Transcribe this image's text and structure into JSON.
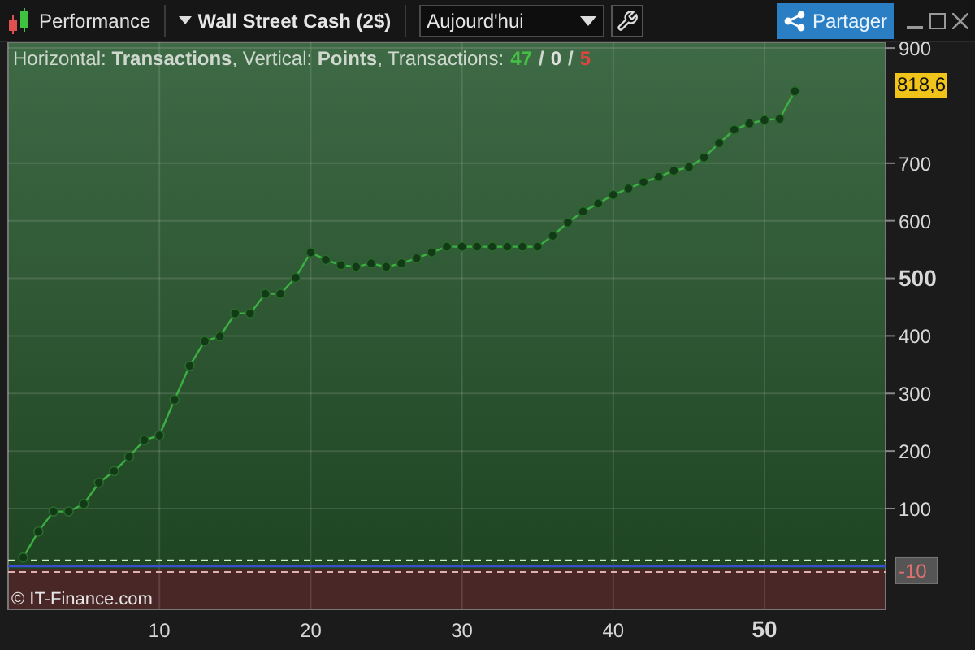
{
  "toolbar": {
    "title": "Performance",
    "instrument": "Wall Street Cash (2$)",
    "period": {
      "value": "Aujourd'hui"
    },
    "share_button": "Partager"
  },
  "legend": {
    "text": "Horizontal: **Transactions**, Vertical: **Points**, Transactions:",
    "counts": [
      {
        "value": "47",
        "color": "#44c144"
      },
      {
        "value": "0",
        "color": "#e0e0e0"
      },
      {
        "value": "5",
        "color": "#e0453f"
      }
    ],
    "separator": "/"
  },
  "watermark": "© IT-Finance.com",
  "current_value": "818,6",
  "chart_data": {
    "type": "line",
    "grid": true,
    "xlim": [
      0,
      58
    ],
    "ylim": [
      -75,
      910
    ],
    "x": [
      1,
      2,
      3,
      4,
      5,
      6,
      7,
      8,
      9,
      10,
      11,
      12,
      13,
      14,
      15,
      16,
      17,
      18,
      19,
      20,
      21,
      22,
      23,
      24,
      25,
      26,
      27,
      28,
      29,
      30,
      31,
      32,
      33,
      34,
      35,
      36,
      37,
      38,
      39,
      40,
      41,
      42,
      43,
      44,
      45,
      46,
      47,
      48,
      49,
      50,
      51,
      52
    ],
    "ref_lines": [
      {
        "axis": "y",
        "value": 10,
        "color": "#c8f0c0"
      },
      {
        "axis": "y",
        "value": 0,
        "color": "#3a4fd0"
      },
      {
        "axis": "y",
        "value": -10,
        "label": "-10",
        "color": "#e0b0b0"
      }
    ],
    "series": [
      {
        "marker": "circle",
        "color": "#3cb043",
        "values": [
          15,
          60,
          95,
          95,
          108,
          145,
          165,
          190,
          219,
          227,
          289,
          348,
          391,
          399,
          439,
          439,
          473,
          473,
          501,
          545,
          532,
          523,
          520,
          526,
          520,
          526,
          535,
          545,
          555,
          555,
          555,
          555,
          555,
          555,
          555,
          574,
          597,
          616,
          630,
          645,
          656,
          667,
          676,
          687,
          693,
          710,
          735,
          758,
          769,
          775,
          777,
          825
        ]
      }
    ],
    "xticks": [
      10,
      20,
      30,
      40,
      50
    ],
    "yticks": [
      100,
      200,
      300,
      400,
      500,
      600,
      700,
      900
    ]
  }
}
